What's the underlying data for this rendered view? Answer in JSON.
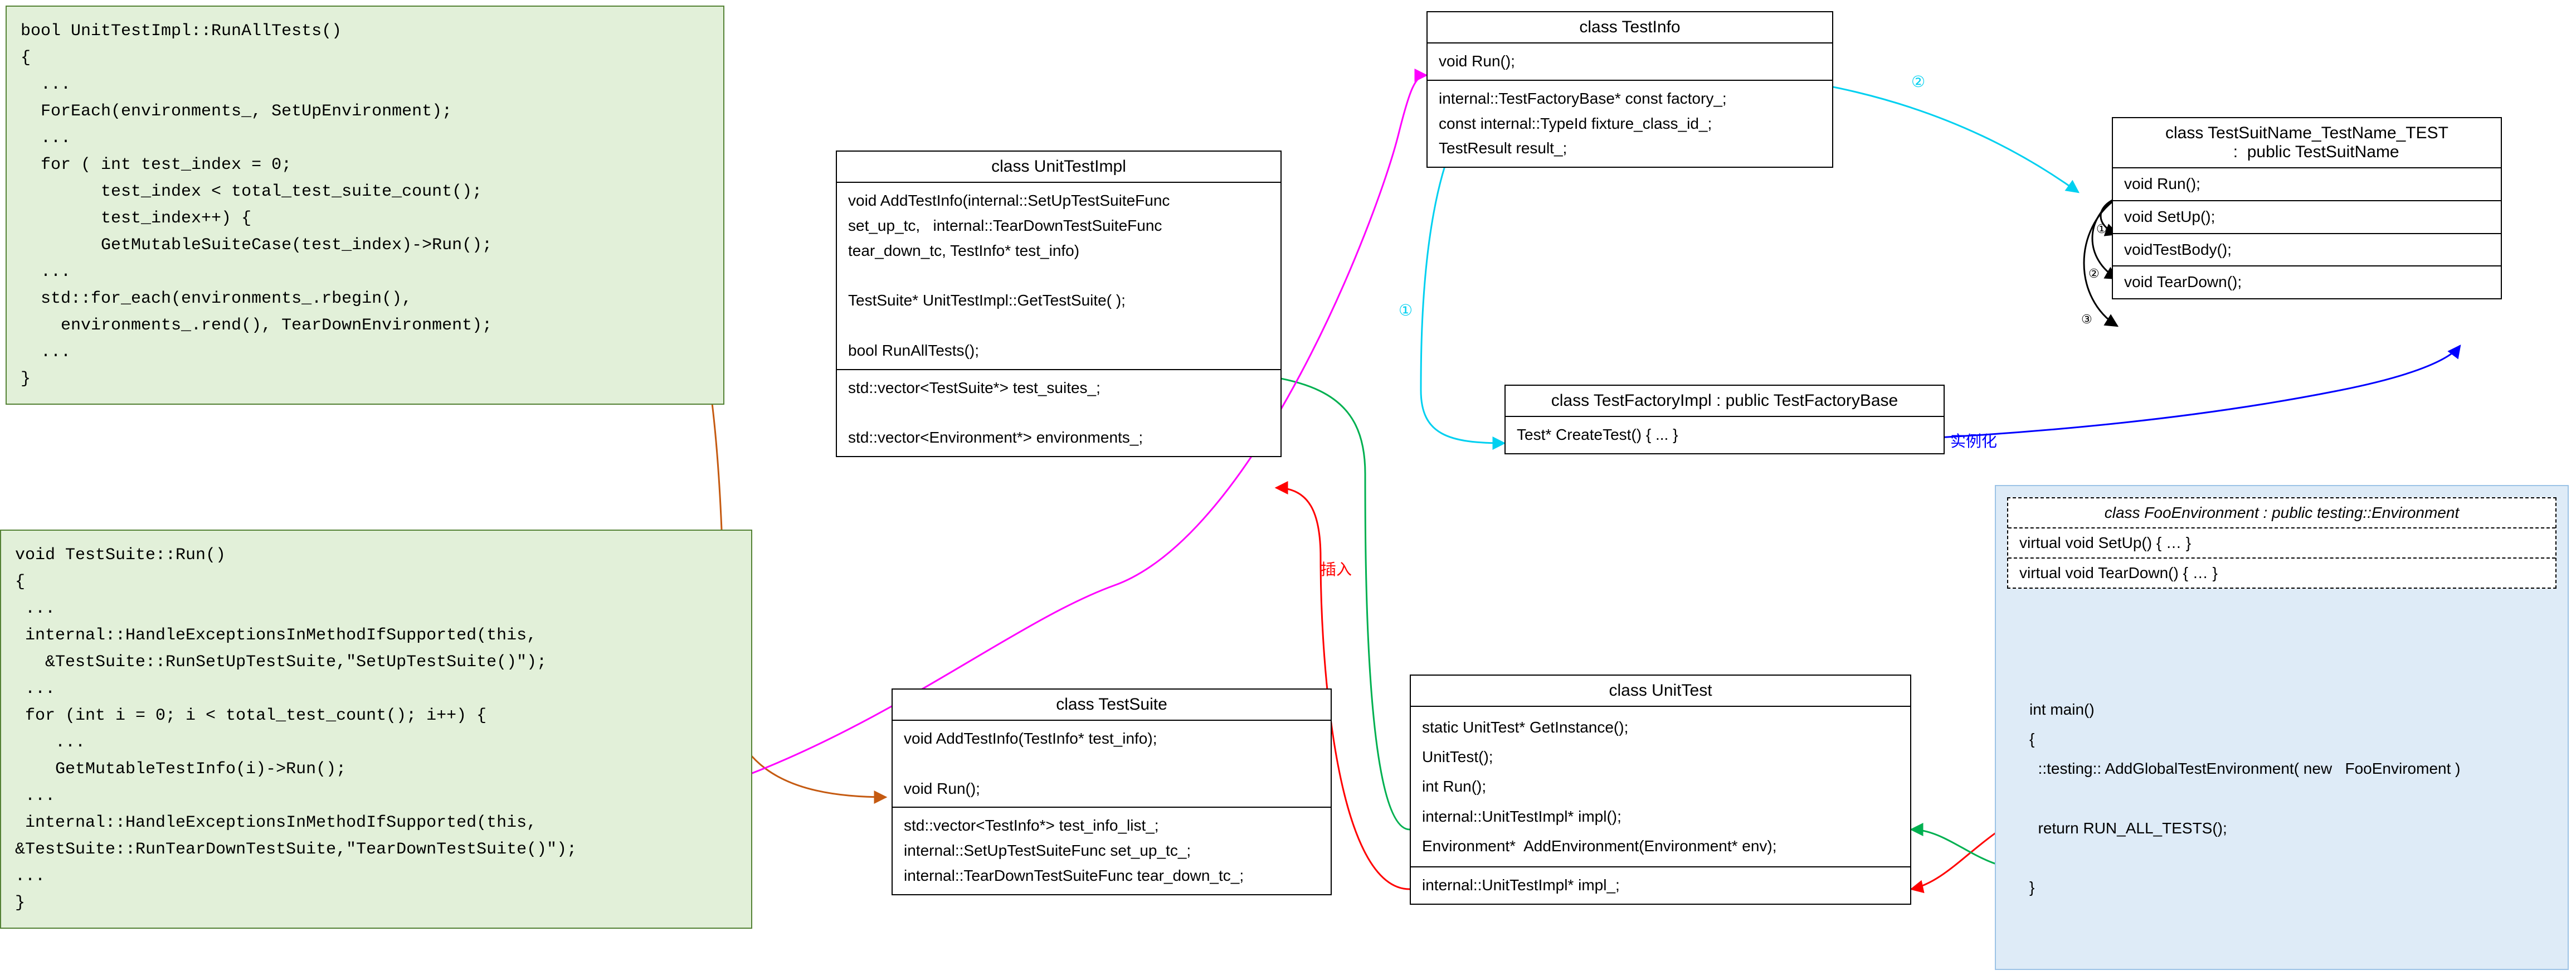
{
  "code1": "bool UnitTestImpl::RunAllTests()\n{\n  ...\n  ForEach(environments_, SetUpEnvironment);\n  ...\n  for ( int test_index = 0;\n        test_index < total_test_suite_count();\n        test_index++) {\n        GetMutableSuiteCase(test_index)->Run();\n  ...\n  std::for_each(environments_.rbegin(),\n    environments_.rend(), TearDownEnvironment);\n  ...\n}",
  "code2": "void TestSuite::Run()\n{\n ...\n internal::HandleExceptionsInMethodIfSupported(this,\n   &TestSuite::RunSetUpTestSuite,\"SetUpTestSuite()\");\n ...\n for (int i = 0; i < total_test_count(); i++) {\n    ...\n    GetMutableTestInfo(i)->Run();\n ...\n internal::HandleExceptionsInMethodIfSupported(this,\n&TestSuite::RunTearDownTestSuite,\"TearDownTestSuite()\");\n...\n}",
  "umlUnitTestImpl": {
    "title": "class  UnitTestImpl",
    "s1": "void AddTestInfo(internal::SetUpTestSuiteFunc\nset_up_tc,   internal::TearDownTestSuiteFunc\ntear_down_tc, TestInfo* test_info)\n\nTestSuite* UnitTestImpl::GetTestSuite( );\n\nbool RunAllTests();",
    "s2": "std::vector<TestSuite*> test_suites_;\n\nstd::vector<Environment*> environments_;"
  },
  "umlTestSuite": {
    "title": "class  TestSuite",
    "s1": "void AddTestInfo(TestInfo* test_info);\n\nvoid Run();",
    "s2": "std::vector<TestInfo*> test_info_list_;\ninternal::SetUpTestSuiteFunc set_up_tc_;\ninternal::TearDownTestSuiteFunc tear_down_tc_;"
  },
  "umlTestInfo": {
    "title": "class  TestInfo",
    "s1": "void Run();",
    "s2": "internal::TestFactoryBase* const factory_;\nconst internal::TypeId fixture_class_id_;\nTestResult result_;"
  },
  "umlTestFactoryImpl": {
    "title": "class TestFactoryImpl : public TestFactoryBase",
    "s1": "Test* CreateTest() { ... }"
  },
  "umlTestSuitName": {
    "title": "class TestSuitName_TestName_TEST\n    :  public TestSuitName",
    "r1": "void Run();",
    "r2": "void SetUp();",
    "r3": "voidTestBody();",
    "r4": "void TearDown();"
  },
  "umlUnitTest": {
    "title": "class  UnitTest",
    "s1": "static UnitTest* GetInstance();\nUnitTest();\nint Run();\ninternal::UnitTestImpl* impl();\nEnvironment*  AddEnvironment(Environment* env);",
    "s2": "internal::UnitTestImpl* impl_;"
  },
  "fooEnv": {
    "title": "class FooEnvironment : public testing::Environment",
    "s1": "virtual void SetUp() { … }",
    "s2": "virtual void TearDown()  { … }"
  },
  "mainCode": "int main()\n{\n  ::testing:: AddGlobalTestEnvironment( new   FooEnviroment )\n\n  return RUN_ALL_TESTS();\n\n}",
  "labels": {
    "insert": "插入",
    "instantiate": "实例化",
    "n1": "①",
    "n2": "②",
    "na": "①",
    "nb": "②",
    "nc": "③"
  }
}
